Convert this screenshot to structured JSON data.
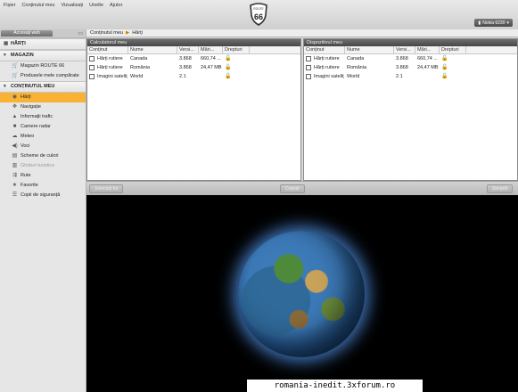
{
  "menu": [
    "Fișier",
    "Conținutul meu",
    "Vizualizați",
    "Unelte",
    "Ajutor"
  ],
  "logo": {
    "top": "ROUTE",
    "num": "66"
  },
  "device_button": "Nokia 6230",
  "left": {
    "access_tab": "Accesați web",
    "section_harti": "HĂRȚI",
    "section_magazin": "MAGAZIN",
    "magazin_items": [
      "Magazin ROUTE 66",
      "Produsele mele cumpărate"
    ],
    "section_continut": "CONȚINUTUL MEU",
    "continut_items": [
      "Hărți",
      "Navigație",
      "Informații trafic",
      "Camere radar",
      "Meteo",
      "Voci",
      "Scheme de culori",
      "Ghiduri turistice",
      "Rute",
      "Favorite",
      "Copii de siguranță"
    ]
  },
  "crumb": {
    "root": "Conținutul meu",
    "current": "Hărți"
  },
  "panels": {
    "left_title": "Calculatorul meu",
    "right_title": "Dispozitivul meu",
    "headers": [
      "Conținut",
      "Nume",
      "Versi...",
      "Mări...",
      "Drepturi"
    ],
    "rows": [
      [
        "Hărți rutiere",
        "Canada",
        "3.868",
        "660,74 ..."
      ],
      [
        "Hărți rutiere",
        "România",
        "3.868",
        "24,47 MB"
      ],
      [
        "Imagini sateliț",
        "World",
        "2.1",
        ""
      ]
    ]
  },
  "buttons": {
    "left": "Selectați tot",
    "mid": "Copiați",
    "right": "Ștergeți"
  },
  "watermark": "romania-inedit.3xforum.ro"
}
